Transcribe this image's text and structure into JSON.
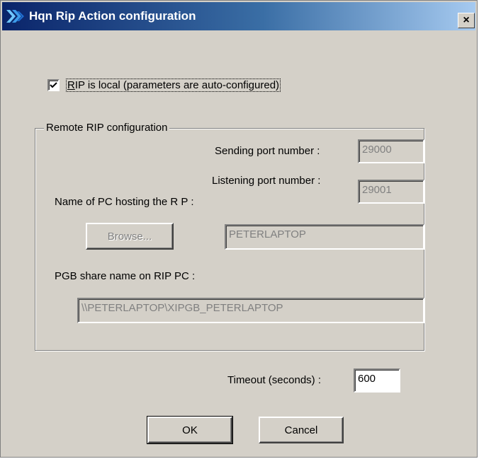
{
  "window": {
    "title": "Hqn Rip Action configuration",
    "close_glyph": "×"
  },
  "rip_local": {
    "label_prefix": "",
    "label_mnemonic": "R",
    "label_rest": "IP is local (parameters are auto-configured)",
    "checked": true
  },
  "remote_group": {
    "title": "Remote RIP configuration",
    "sending_port_label": "Sending port number :",
    "sending_port_value": "29000",
    "listening_port_label": "Listening port number :",
    "listening_port_value": "29001",
    "pc_name_label": "Name of PC hosting the R P :",
    "browse_label": "Browse...",
    "pc_name_value": "PETERLAPTOP",
    "share_label": "PGB share name on RIP PC :",
    "share_value": "\\\\PETERLAPTOP\\XIPGB_PETERLAPTOP"
  },
  "timeout": {
    "label": "Timeout (seconds) :",
    "value": "600"
  },
  "buttons": {
    "ok_label": "OK",
    "cancel_label": "Cancel"
  },
  "colors": {
    "face": "#d4d0c8",
    "title_start": "#0a246a",
    "title_end": "#a6caf0",
    "disabled_text": "#808080"
  },
  "icons": {
    "app": "hqn-app-icon",
    "close": "close-icon",
    "check": "checkmark-icon"
  }
}
